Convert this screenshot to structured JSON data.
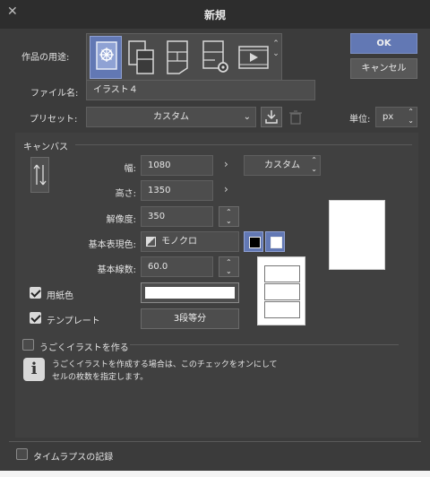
{
  "window": {
    "title": "新規"
  },
  "usage": {
    "label": "作品の用途:",
    "icons": [
      "illustration-preset-icon",
      "webtoon-icon",
      "comic-icon",
      "comic-settings-icon",
      "animation-icon"
    ]
  },
  "buttons": {
    "ok": "OK",
    "cancel": "キャンセル"
  },
  "file_name": {
    "label": "ファイル名:",
    "value": "イラスト４"
  },
  "preset": {
    "label": "プリセット:",
    "value": "カスタム"
  },
  "unit": {
    "label": "単位:",
    "value": "px"
  },
  "canvas": {
    "section_label": "キャンバス",
    "width": {
      "label": "幅:",
      "value": "1080"
    },
    "height": {
      "label": "高さ:",
      "value": "1350"
    },
    "size_preset": "カスタム",
    "resolution": {
      "label": "解像度:",
      "value": "350"
    },
    "color_mode": {
      "label": "基本表現色:",
      "value": "モノクロ"
    },
    "lines": {
      "label": "基本線数:",
      "value": "60.0"
    },
    "paper": {
      "label": "用紙色",
      "checked": true
    },
    "template": {
      "label": "テンプレート",
      "checked": true,
      "value": "3段等分"
    }
  },
  "animation": {
    "label": "うごくイラストを作る",
    "checked": false,
    "info_line1": "うごくイラストを作成する場合は、このチェックをオンにして",
    "info_line2": "セルの枚数を指定します。"
  },
  "timelapse": {
    "label": "タイムラプスの記録",
    "checked": false
  },
  "colors": {
    "accent": "#6278b4",
    "dialog_bg": "#3b3b3b",
    "titlebar_bg": "#2d2d2d"
  }
}
